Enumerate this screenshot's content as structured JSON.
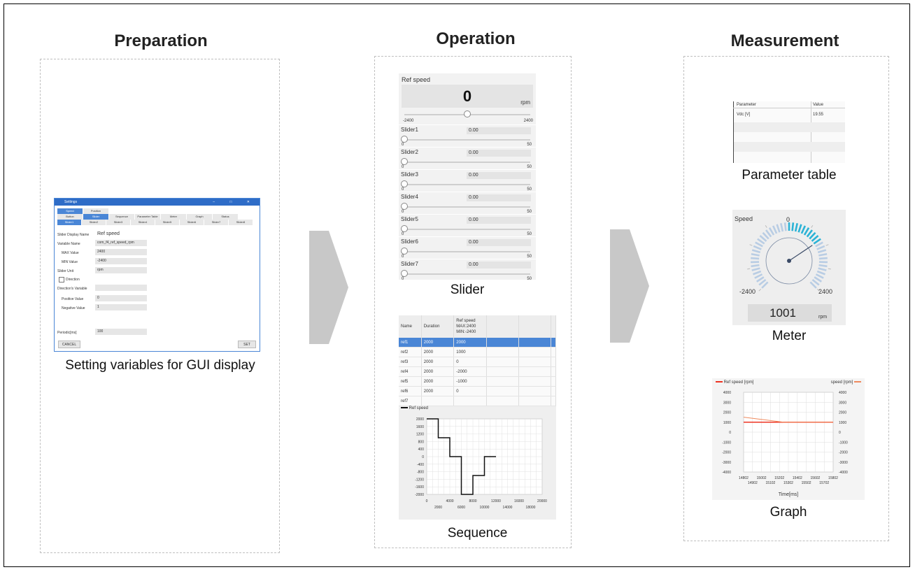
{
  "columns": {
    "preparation": "Preparation",
    "operation": "Operation",
    "measurement": "Measurement"
  },
  "captions": {
    "settings": "Setting variables for GUI display",
    "slider": "Slider",
    "sequence": "Sequence",
    "parameter_table": "Parameter table",
    "meter": "Meter",
    "graph": "Graph"
  },
  "settings_window": {
    "title": "Settings",
    "top_tabs": [
      "Speed",
      "Position"
    ],
    "control_tabs": [
      "Button",
      "Slider",
      "Sequence",
      "Parameter Table",
      "Meter",
      "Graph",
      "Status"
    ],
    "slider_tabs": [
      "Slider1",
      "Slider2",
      "Slider3",
      "Slider4",
      "Slider5",
      "Slider6",
      "Slider7",
      "Slider8"
    ],
    "fields": {
      "display_name_label": "Slider Display Name",
      "display_name_value": "Ref speed",
      "variable_name_label": "Variable Name",
      "variable_name_value": "com_f4_ref_speed_rpm",
      "max_label": "MAX Value",
      "max_value": "2400",
      "min_label": "MIN Value",
      "min_value": "-2400",
      "unit_label": "Slider Unit",
      "unit_value": "rpm",
      "direction_label": "Direction",
      "direction_var_label": "Direction's Variable",
      "positive_label": "Positive Value",
      "positive_value": "0",
      "negative_label": "Negative Value",
      "negative_value": "1",
      "period_label": "Periodic[ms]",
      "period_value": "100"
    },
    "cancel": "CANCEL",
    "set": "SET"
  },
  "slider_panel": {
    "title": "Ref speed",
    "value": "0",
    "unit": "rpm",
    "min": "-2400",
    "max": "2400",
    "sliders": [
      {
        "name": "Slider1",
        "value": "0.00",
        "min": "0",
        "max": "50"
      },
      {
        "name": "Slider2",
        "value": "0.00",
        "min": "0",
        "max": "50"
      },
      {
        "name": "Slider3",
        "value": "0.00",
        "min": "0",
        "max": "50"
      },
      {
        "name": "Slider4",
        "value": "0.00",
        "min": "0",
        "max": "50"
      },
      {
        "name": "Slider5",
        "value": "0.00",
        "min": "0",
        "max": "50"
      },
      {
        "name": "Slider6",
        "value": "0.00",
        "min": "0",
        "max": "50"
      },
      {
        "name": "Slider7",
        "value": "0.00",
        "min": "0",
        "max": "50"
      }
    ]
  },
  "sequence_panel": {
    "headers": [
      "Name",
      "Duration",
      "Ref speed",
      "MAX:2400",
      "MIN:-2400"
    ],
    "rows": [
      {
        "name": "ref1",
        "duration": "2000",
        "speed": "2000"
      },
      {
        "name": "ref2",
        "duration": "2000",
        "speed": "1000"
      },
      {
        "name": "ref3",
        "duration": "2000",
        "speed": "0"
      },
      {
        "name": "ref4",
        "duration": "2000",
        "speed": "-2000"
      },
      {
        "name": "ref5",
        "duration": "2000",
        "speed": "-1000"
      },
      {
        "name": "ref6",
        "duration": "2000",
        "speed": "0"
      },
      {
        "name": "ref7",
        "duration": "",
        "speed": ""
      }
    ],
    "legend": "Ref speed"
  },
  "parameter_table": {
    "headers": [
      "Parameter",
      "Value"
    ],
    "rows": [
      {
        "param": "Vdc [V]",
        "value": "19.55"
      }
    ]
  },
  "meter_panel": {
    "title": "Speed",
    "top": "0",
    "min": "-2400",
    "max": "2400",
    "value": "1001",
    "unit": "rpm",
    "needle_value": 1001,
    "range": [
      -2400,
      2400
    ]
  },
  "graph_panel": {
    "legend_left": "Ref speed [rpm]",
    "legend_right": "speed [rpm]",
    "xlabel": "Time[ms]",
    "colors": {
      "ref": "#ee3322",
      "speed": "#f08a5d"
    }
  },
  "chart_data": [
    {
      "type": "line",
      "name": "sequence",
      "series": [
        {
          "name": "Ref speed",
          "x": [
            0,
            2000,
            2000,
            4000,
            4000,
            6000,
            6000,
            8000,
            8000,
            10000,
            10000,
            12000
          ],
          "y": [
            2000,
            2000,
            1000,
            1000,
            0,
            0,
            -2000,
            -2000,
            -1000,
            -1000,
            0,
            0
          ]
        }
      ],
      "xlim": [
        0,
        20000
      ],
      "ylim": [
        -2000,
        2000
      ],
      "x_ticks_top": [
        "0",
        "4000",
        "8000",
        "12000",
        "16000",
        "20000"
      ],
      "x_ticks_bottom": [
        "2000",
        "6000",
        "10000",
        "14000",
        "18000"
      ],
      "y_ticks": [
        "2000",
        "1600",
        "1200",
        "800",
        "400",
        "0",
        "-400",
        "-800",
        "-1200",
        "-1600",
        "-2000"
      ],
      "grid": true
    },
    {
      "type": "line",
      "name": "graph",
      "series": [
        {
          "name": "Ref speed [rpm]",
          "x": [
            14802,
            15802
          ],
          "y": [
            1000,
            1000
          ]
        },
        {
          "name": "speed [rpm]",
          "x": [
            14802,
            15250,
            15802
          ],
          "y": [
            1500,
            1000,
            1000
          ]
        }
      ],
      "xlim": [
        14802,
        15802
      ],
      "ylim": [
        -4000,
        4000
      ],
      "x_ticks_top": [
        "14802",
        "15002",
        "15202",
        "15402",
        "15602",
        "15802"
      ],
      "x_ticks_bottom": [
        "14902",
        "15102",
        "15302",
        "15502",
        "15702"
      ],
      "y_ticks": [
        "4000",
        "3000",
        "2000",
        "1000",
        "0",
        "-1000",
        "-2000",
        "-3000",
        "-4000"
      ],
      "grid": true
    }
  ]
}
